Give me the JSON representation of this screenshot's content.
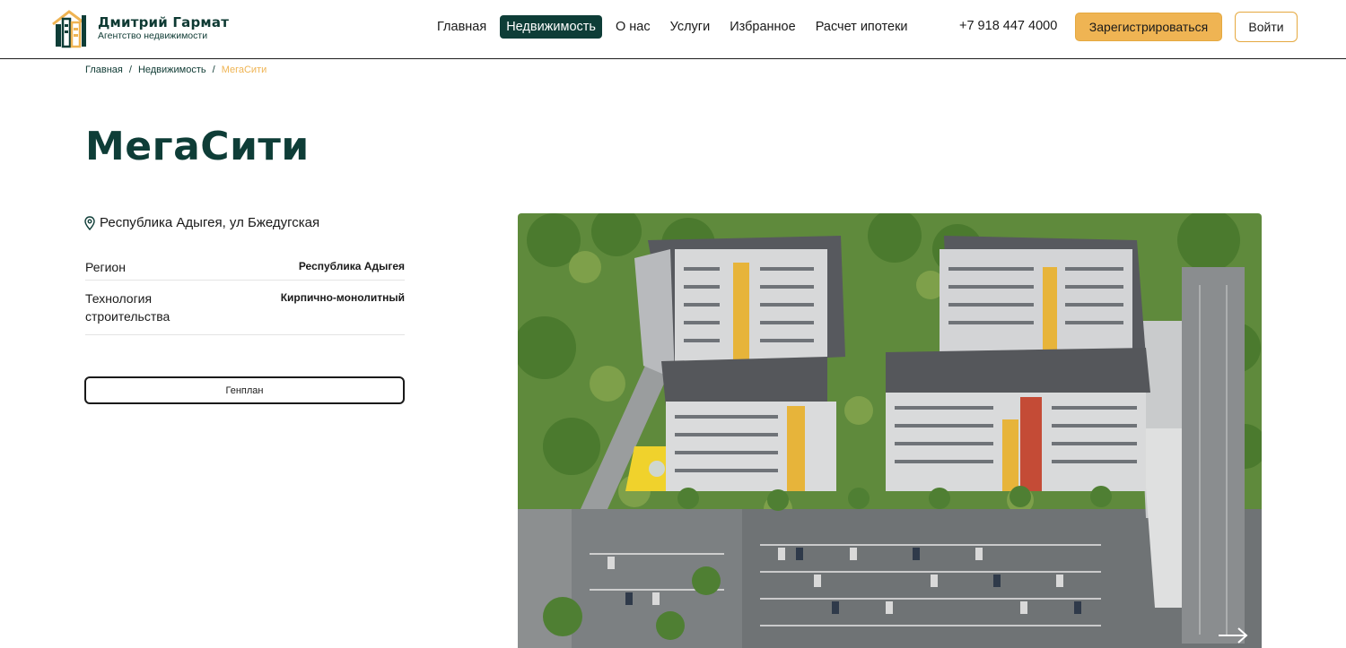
{
  "header": {
    "logo_name": "Дмитрий Гармат",
    "logo_subtitle": "Агентство недвижимости",
    "nav": [
      {
        "label": "Главная",
        "active": false
      },
      {
        "label": "Недвижимость",
        "active": true
      },
      {
        "label": "О нас",
        "active": false
      },
      {
        "label": "Услуги",
        "active": false
      },
      {
        "label": "Избранное",
        "active": false
      },
      {
        "label": "Расчет ипотеки",
        "active": false
      }
    ],
    "phone": "+7 918 447 4000",
    "register_label": "Зарегистрироваться",
    "login_label": "Войти"
  },
  "breadcrumb": {
    "items": [
      "Главная",
      "Недвижимость"
    ],
    "separator": "/",
    "current": "МегаСити"
  },
  "page": {
    "title": "МегаСити",
    "address": "Республика Адыгея, ул Бжедугская",
    "details": [
      {
        "label": "Регион",
        "value": "Республика Адыгея"
      },
      {
        "label": "Технология строительства",
        "value": "Кирпично-монолитный"
      }
    ],
    "genplan_label": "Генплан"
  },
  "colors": {
    "brand_dark": "#0e3d37",
    "accent": "#efb453",
    "divider": "#e4e4e4"
  },
  "icons": {
    "location": "map-pin-icon",
    "slider_next": "arrow-right-icon"
  }
}
